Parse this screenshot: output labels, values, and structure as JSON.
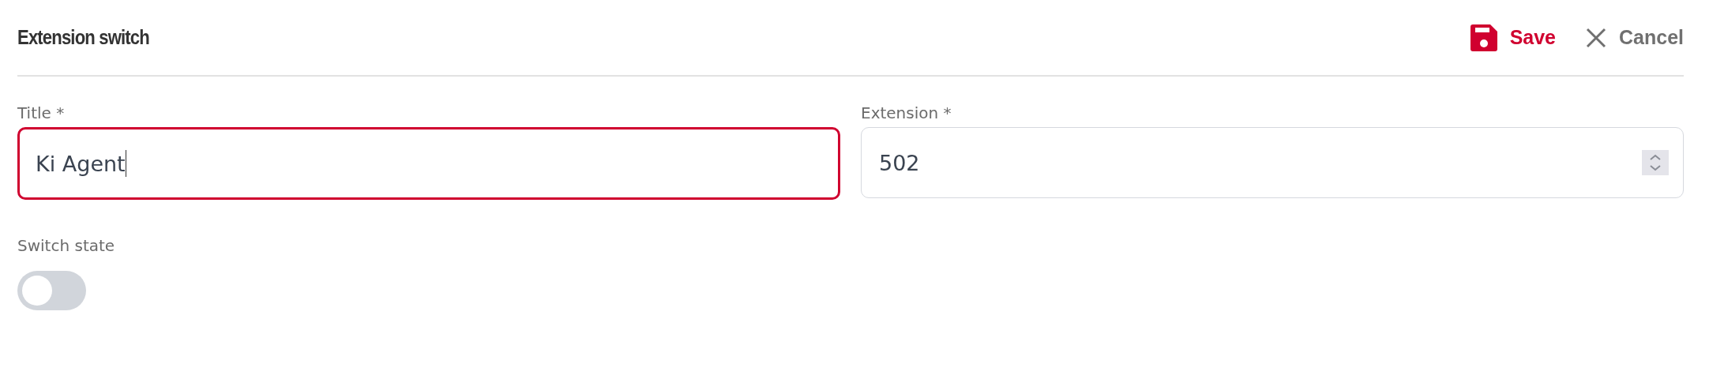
{
  "header": {
    "title": "Extension switch",
    "actions": [
      {
        "kind": "save",
        "label": "Save"
      },
      {
        "kind": "cancel",
        "label": "Cancel"
      }
    ]
  },
  "fields": [
    {
      "kind": "text",
      "label": "Title *",
      "value": "Ki Agent",
      "focused": true
    },
    {
      "kind": "number",
      "label": "Extension *",
      "value": "502",
      "focused": false
    }
  ],
  "switch": {
    "label": "Switch state",
    "on": false
  }
}
